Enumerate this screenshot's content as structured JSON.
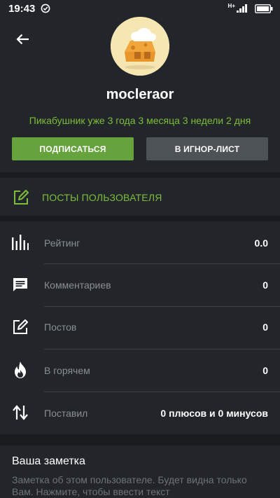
{
  "status_bar": {
    "time": "19:43",
    "network": "H+"
  },
  "profile": {
    "username": "mocleraor",
    "since": "Пикабушник уже 3 года 3 месяца 3 недели 2 дня",
    "subscribe_label": "ПОДПИСАТЬСЯ",
    "ignore_label": "В ИГНОР-ЛИСТ"
  },
  "posts_link": {
    "label": "ПОСТЫ ПОЛЬЗОВАТЕЛЯ"
  },
  "stats": [
    {
      "icon": "rating-bars-icon",
      "label": "Рейтинг",
      "value": "0.0"
    },
    {
      "icon": "comment-icon",
      "label": "Комментариев",
      "value": "0"
    },
    {
      "icon": "edit-icon",
      "label": "Постов",
      "value": "0"
    },
    {
      "icon": "fire-icon",
      "label": "В горячем",
      "value": "0"
    },
    {
      "icon": "swap-vertical-icon",
      "label": "Поставил",
      "value": "0 плюсов и 0 минусов"
    }
  ],
  "note": {
    "title": "Ваша заметка",
    "placeholder": "Заметка об этом пользователе. Будет видна только Вам. Нажмите, чтобы ввести текст"
  },
  "colors": {
    "background": "#22262a",
    "accent_green": "#7ebd3a",
    "subscribe_button": "#67a33c",
    "ignore_button": "#4d5256"
  }
}
